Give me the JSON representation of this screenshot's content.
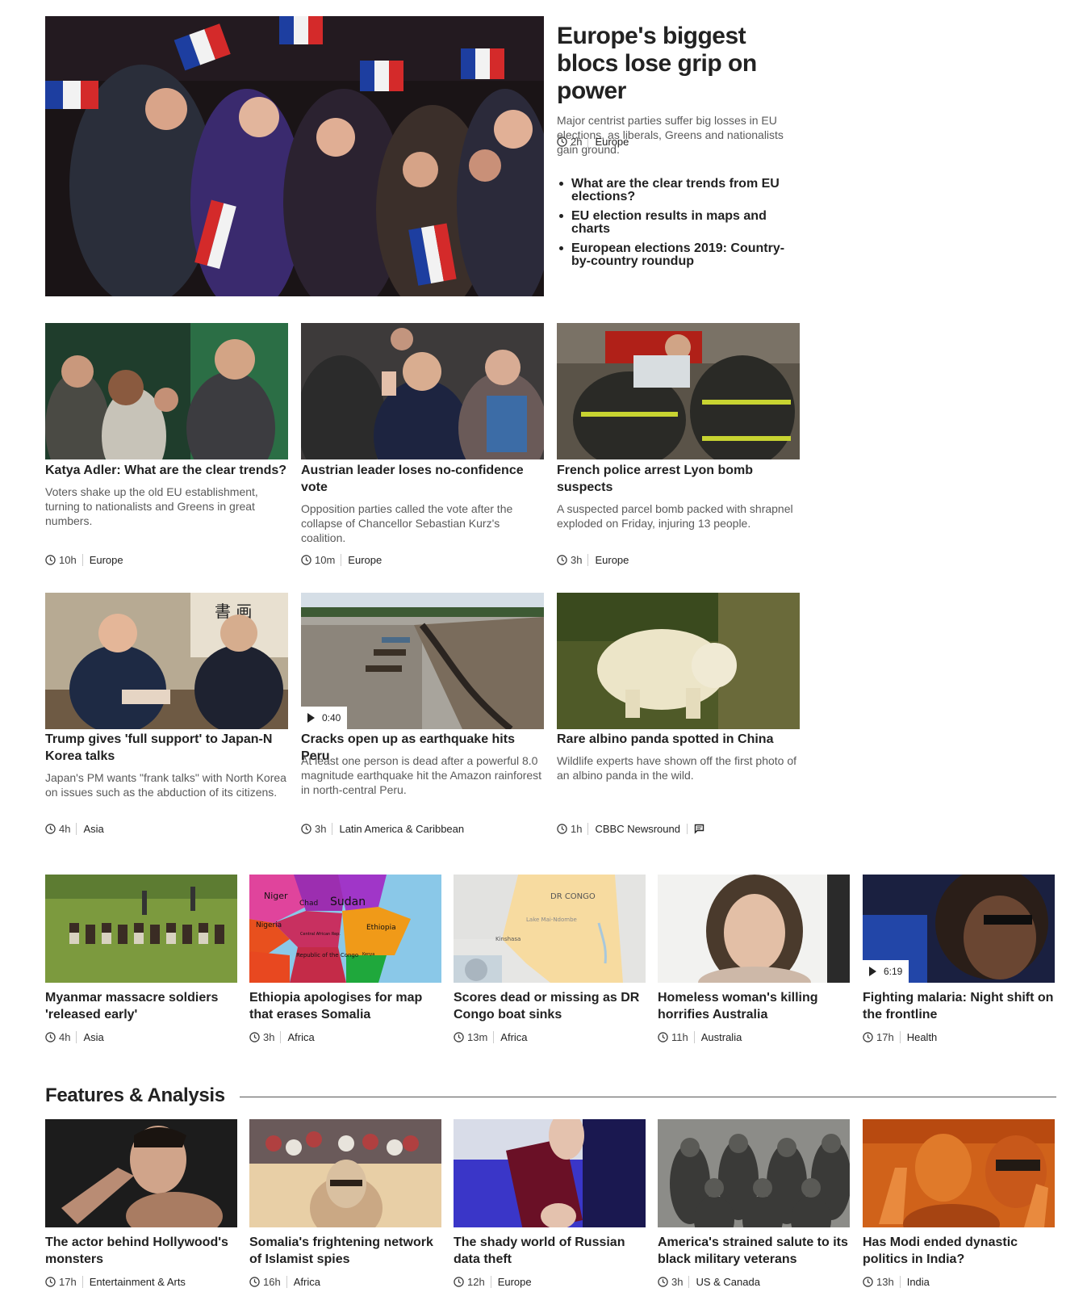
{
  "top_story": {
    "headline": "Europe's biggest blocs lose grip on power",
    "summary": "Major centrist parties suffer big losses in EU elections, as liberals, Greens and nationalists gain ground.",
    "time": "2h",
    "section": "Europe",
    "related": [
      "What are the clear trends from EU elections?",
      "EU election results in maps and charts",
      "European elections 2019: Country-by-country roundup"
    ]
  },
  "row1": [
    {
      "headline": "Katya Adler: What are the clear trends?",
      "summary": "Voters shake up the old EU establishment, turning to nationalists and Greens in great numbers.",
      "time": "10h",
      "section": "Europe"
    },
    {
      "headline": "Austrian leader loses no-confidence vote",
      "summary": "Opposition parties called the vote after the collapse of Chancellor Sebastian Kurz's coalition.",
      "time": "10m",
      "section": "Europe"
    },
    {
      "headline": "French police arrest Lyon bomb suspects",
      "summary": "A suspected parcel bomb packed with shrapnel exploded on Friday, injuring 13 people.",
      "time": "3h",
      "section": "Europe"
    }
  ],
  "row2": [
    {
      "headline": "Trump gives 'full support' to Japan-N Korea talks",
      "summary": "Japan's PM wants \"frank talks\" with North Korea on issues such as the abduction of its citizens.",
      "time": "4h",
      "section": "Asia"
    },
    {
      "headline": "Cracks open up as earthquake hits Peru",
      "summary": "At least one person is dead after a powerful 8.0 magnitude earthquake hit the Amazon rainforest in north-central Peru.",
      "time": "3h",
      "section": "Latin America & Caribbean",
      "video_duration": "0:40"
    },
    {
      "headline": "Rare albino panda spotted in China",
      "summary": "Wildlife experts have shown off the first photo of an albino panda in the wild.",
      "time": "1h",
      "section": "CBBC Newsround"
    }
  ],
  "row3": [
    {
      "headline": "Myanmar massacre soldiers 'released early'",
      "time": "4h",
      "section": "Asia"
    },
    {
      "headline": "Ethiopia apologises for map that erases Somalia",
      "time": "3h",
      "section": "Africa",
      "map_labels": [
        "Niger",
        "Chad",
        "Sudan",
        "Nigeria",
        "Ethiopia",
        "Central African Rep.",
        "Republic of the Congo",
        "Kenya"
      ]
    },
    {
      "headline": "Scores dead or missing as DR Congo boat sinks",
      "time": "13m",
      "section": "Africa",
      "map_labels": [
        "DR CONGO",
        "Lake Mai-Ndombe",
        "Kinshasa"
      ]
    },
    {
      "headline": "Homeless woman's killing horrifies Australia",
      "time": "11h",
      "section": "Australia"
    },
    {
      "headline": "Fighting malaria: Night shift on the frontline",
      "time": "17h",
      "section": "Health",
      "video_duration": "6:19"
    }
  ],
  "features": {
    "heading": "Features & Analysis",
    "items": [
      {
        "headline": "The actor behind Hollywood's monsters",
        "time": "17h",
        "section": "Entertainment & Arts"
      },
      {
        "headline": "Somalia's frightening network of Islamist spies",
        "time": "16h",
        "section": "Africa"
      },
      {
        "headline": "The shady world of Russian data theft",
        "time": "12h",
        "section": "Europe"
      },
      {
        "headline": "America's strained salute to its black military veterans",
        "time": "3h",
        "section": "US & Canada"
      },
      {
        "headline": "Has Modi ended dynastic politics in India?",
        "time": "13h",
        "section": "India"
      }
    ]
  }
}
